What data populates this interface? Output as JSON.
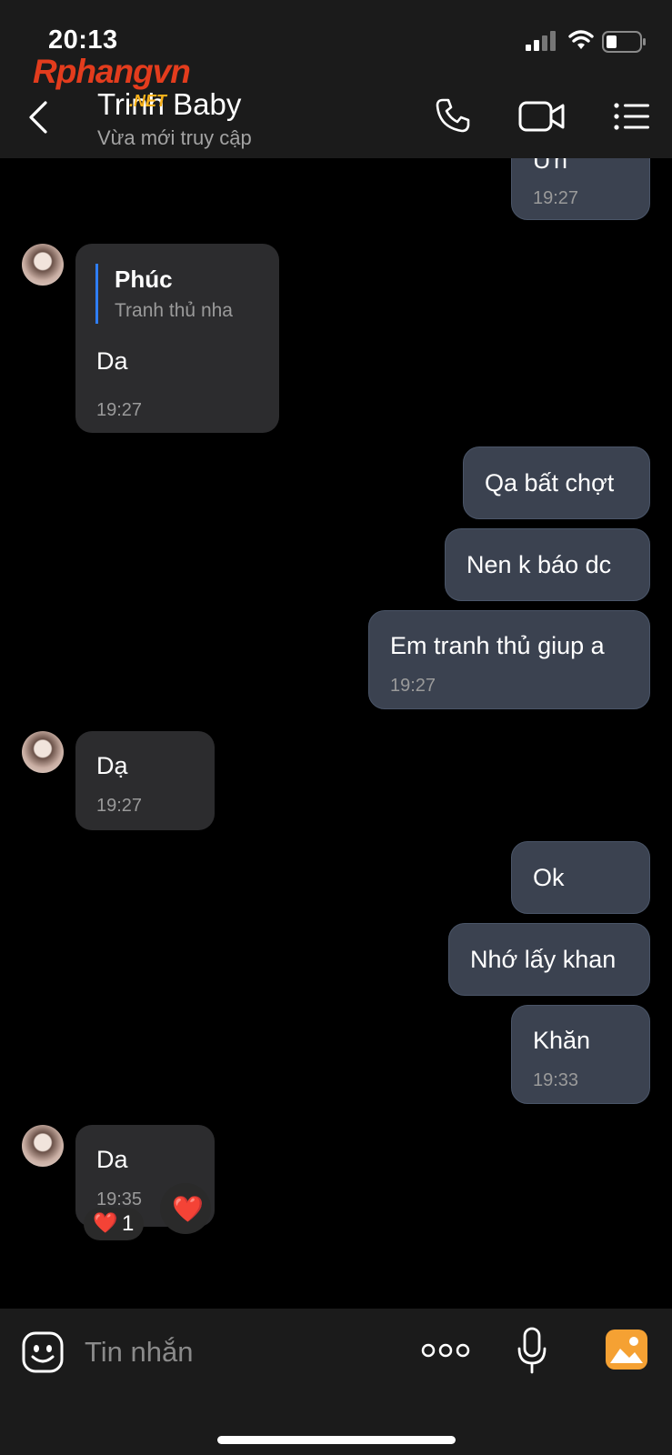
{
  "status_bar": {
    "time": "20:13"
  },
  "header": {
    "watermark": "Rphangvn",
    "watermark_sub": ".NET",
    "title": "Trinh Baby",
    "subtitle": "Vừa mới truy cập"
  },
  "messages": [
    {
      "text": "Ưh",
      "time": "19:27"
    },
    {
      "quote_name": "Phúc",
      "quote_text": "Tranh thủ nha",
      "text": "Da",
      "time": "19:27"
    },
    {
      "text": "Qa bất chợt"
    },
    {
      "text": "Nen k báo dc"
    },
    {
      "text": "Em tranh thủ giup a",
      "time": "19:27"
    },
    {
      "text": "Dạ",
      "time": "19:27"
    },
    {
      "text": "Ok"
    },
    {
      "text": "Nhớ lấy khan"
    },
    {
      "text": "Khăn",
      "time": "19:33"
    },
    {
      "text": "Da",
      "time": "19:35"
    }
  ],
  "reaction": {
    "emoji": "❤️",
    "count": "1",
    "quick_emoji": "❤️"
  },
  "footer": {
    "placeholder": "Tin nhắn"
  },
  "colors": {
    "background": "#000000",
    "incoming_bubble": "#2c2c2e",
    "outgoing_bubble": "#3b4250",
    "quote_accent": "#2f7ef5",
    "gallery_icon": "#f5a133"
  }
}
